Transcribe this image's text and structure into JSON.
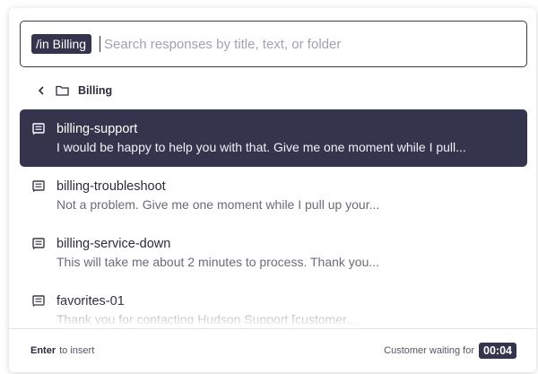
{
  "search": {
    "scope_chip": "/in Billing",
    "placeholder": "Search responses by title, text, or folder",
    "value": ""
  },
  "breadcrumb": {
    "back_icon": "chevron-left-icon",
    "folder_icon": "folder-icon",
    "folder_name": "Billing"
  },
  "responses": [
    {
      "title": "billing-support",
      "preview": "I would be happy to help you with that. Give me one moment while I pull...",
      "selected": true,
      "icon": "message-icon"
    },
    {
      "title": "billing-troubleshoot",
      "preview": "Not a problem. Give me one moment while I pull up your...",
      "selected": false,
      "icon": "message-icon"
    },
    {
      "title": "billing-service-down",
      "preview": "This will take me about 2 minutes to process. Thank you...",
      "selected": false,
      "icon": "message-icon"
    },
    {
      "title": "favorites-01",
      "preview": "Thank you for contacting Hudson Support [customer...",
      "selected": false,
      "icon": "message-icon"
    }
  ],
  "footer": {
    "hint_key": "Enter",
    "hint_text": "to insert",
    "waiting_label": "Customer waiting for",
    "waiting_time": "00:04"
  },
  "colors": {
    "accent": "#34354d",
    "selected_text": "#ffffff",
    "muted_text": "#6b6b78"
  }
}
